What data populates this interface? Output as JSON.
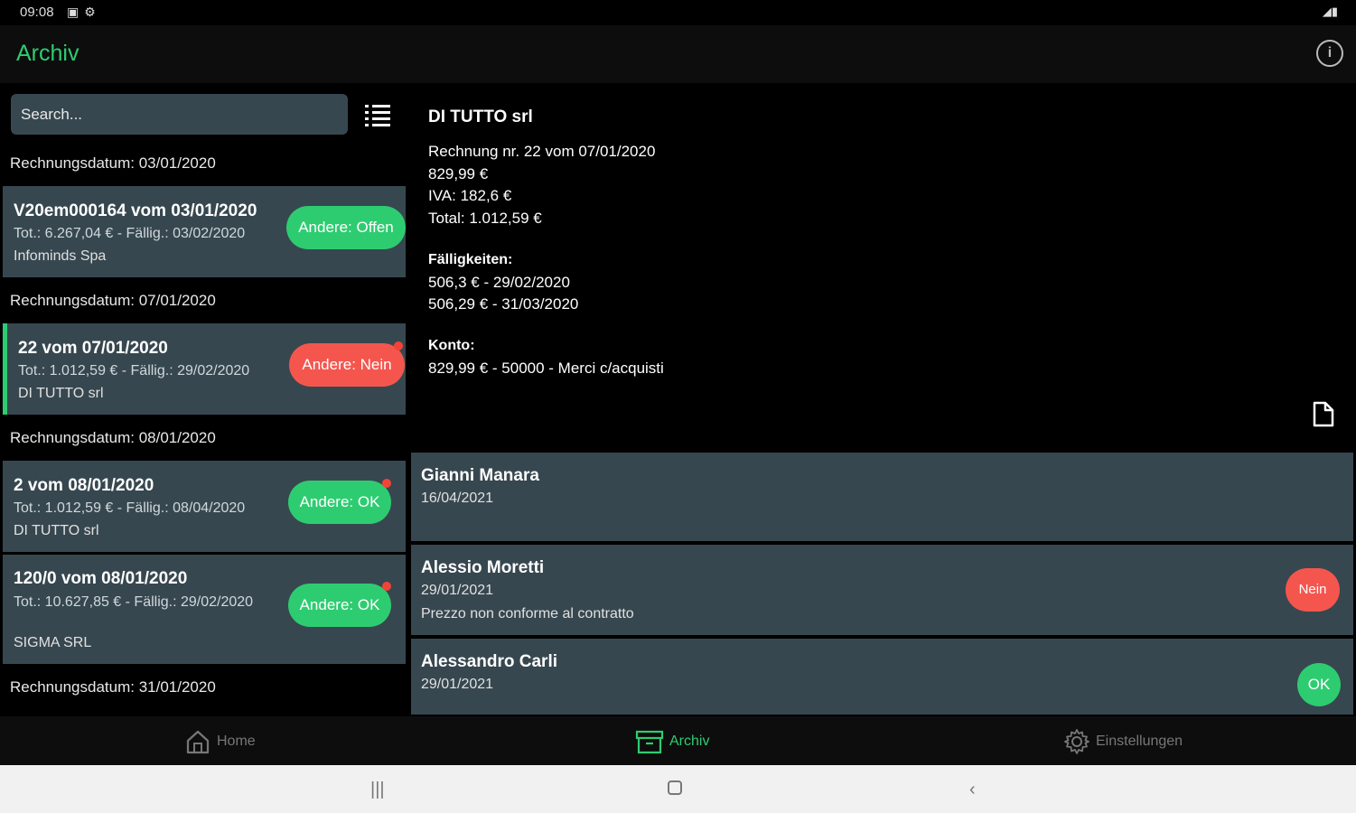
{
  "status": {
    "time": "09:08"
  },
  "app": {
    "title": "Archiv"
  },
  "search": {
    "placeholder": "Search..."
  },
  "list": {
    "groups": [
      {
        "header": "Rechnungsdatum: 03/01/2020"
      },
      {
        "header": "Rechnungsdatum: 07/01/2020"
      },
      {
        "header": "Rechnungsdatum: 08/01/2020"
      },
      {
        "header": "Rechnungsdatum: 31/01/2020"
      }
    ],
    "items": [
      {
        "title": "V20em000164 vom 03/01/2020",
        "subtitle": "Tot.: 6.267,04 € - Fällig.: 03/02/2020",
        "company": "Infominds Spa",
        "badge": "Andere: Offen"
      },
      {
        "title": "22 vom 07/01/2020",
        "subtitle": "Tot.: 1.012,59 € - Fällig.: 29/02/2020",
        "company": "DI TUTTO srl",
        "badge": "Andere: Nein"
      },
      {
        "title": "2 vom 08/01/2020",
        "subtitle": "Tot.: 1.012,59 € - Fällig.: 08/04/2020",
        "company": "DI TUTTO srl",
        "badge": "Andere: OK"
      },
      {
        "title": "120/0 vom 08/01/2020",
        "subtitle": "Tot.: 10.627,85 € - Fällig.: 29/02/2020",
        "company": "SIGMA SRL",
        "badge": "Andere: OK"
      }
    ]
  },
  "detail": {
    "company": "DI TUTTO srl",
    "invoice": "Rechnung nr. 22 vom 07/01/2020",
    "net": "829,99 €",
    "iva": "IVA: 182,6 €",
    "total": "Total: 1.012,59 €",
    "due_label": "Fälligkeiten:",
    "due": [
      "506,3 € - 29/02/2020",
      "506,29 € - 31/03/2020"
    ],
    "account_label": "Konto:",
    "account": "829,99 € - 50000 - Merci c/acquisti"
  },
  "approvals": [
    {
      "name": "Gianni Manara",
      "date": "16/04/2021",
      "note": "",
      "status": ""
    },
    {
      "name": "Alessio Moretti",
      "date": "29/01/2021",
      "note": "Prezzo non conforme al contratto",
      "status": "Nein"
    },
    {
      "name": "Alessandro Carli",
      "date": "29/01/2021",
      "note": "",
      "status": "OK"
    }
  ],
  "nav": {
    "home": "Home",
    "archiv": "Archiv",
    "settings": "Einstellungen"
  },
  "colors": {
    "accent": "#2ecc71",
    "card": "#37474f",
    "danger": "#f4564e"
  }
}
